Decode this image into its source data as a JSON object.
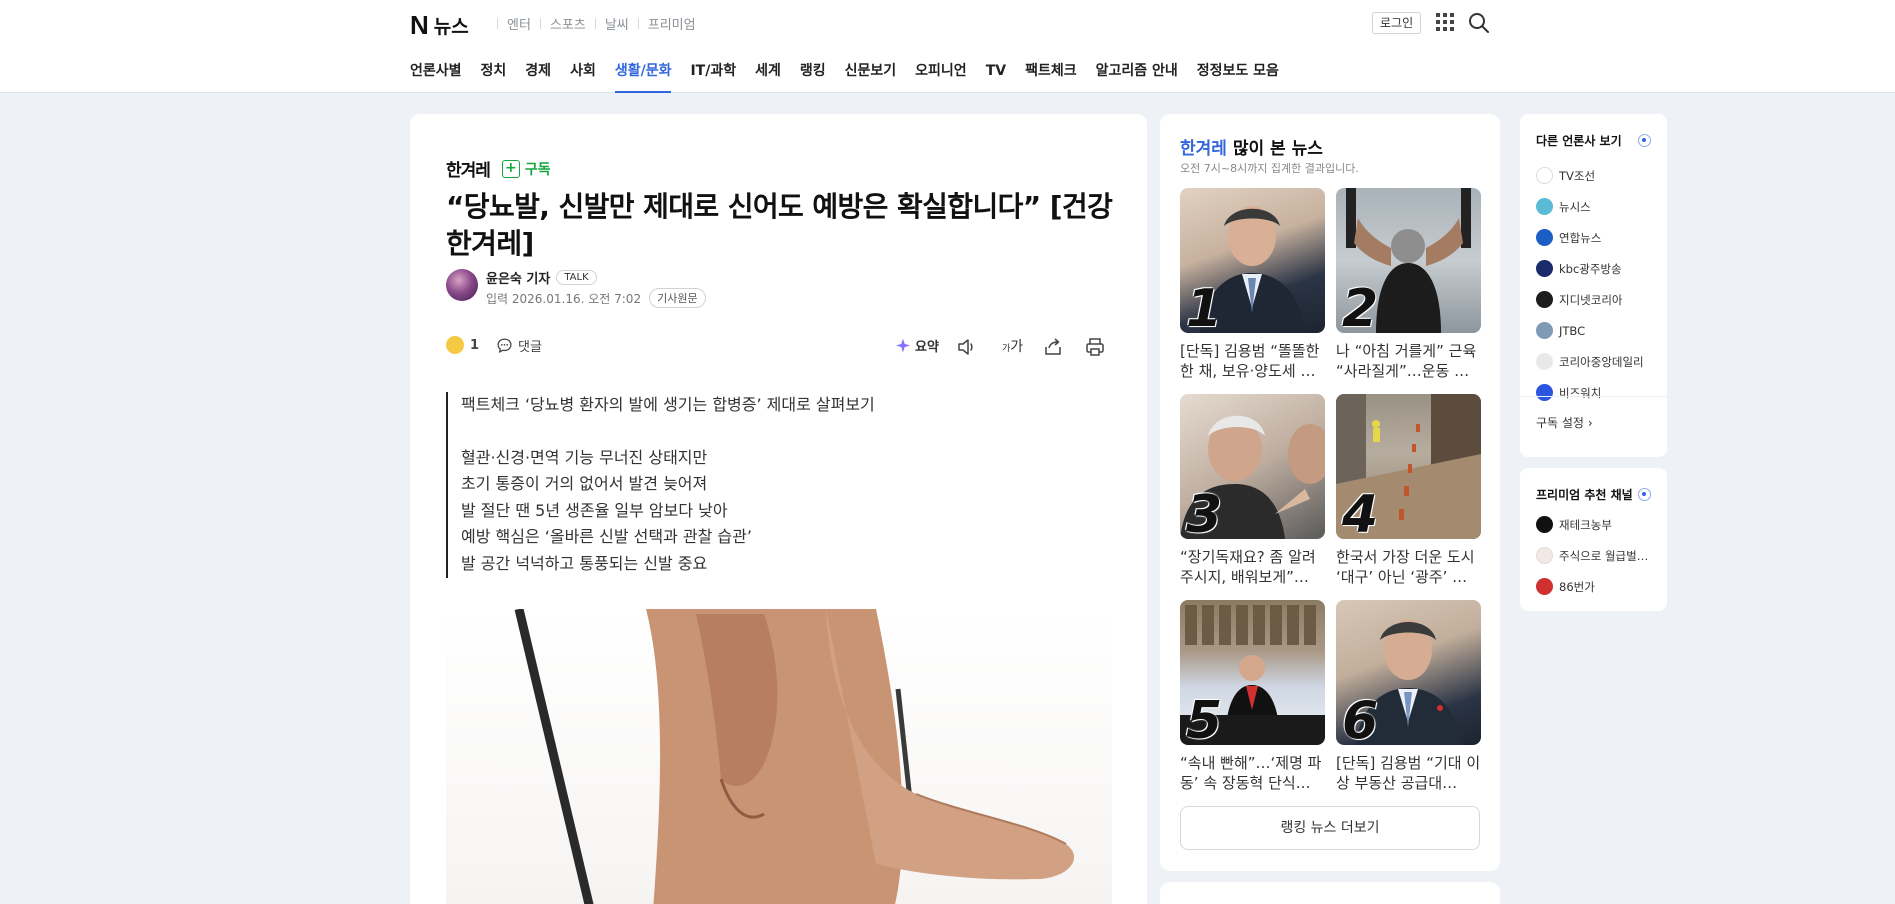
{
  "header": {
    "logo_n": "N",
    "logo_text": "뉴스",
    "top_links": [
      "엔터",
      "스포츠",
      "날씨",
      "프리미엄"
    ],
    "login_label": "로그인",
    "icons": {
      "apps": "apps-grid-icon",
      "search": "search-icon"
    }
  },
  "nav": {
    "items": [
      "언론사별",
      "정치",
      "경제",
      "사회",
      "생활/문화",
      "IT/과학",
      "세계",
      "랭킹",
      "신문보기",
      "오피니언",
      "TV",
      "팩트체크",
      "알고리즘 안내",
      "정정보도 모음"
    ],
    "active": "생활/문화",
    "accent_color": "#3366dd"
  },
  "article": {
    "press_name": "한겨레",
    "subscribe_label": "구독",
    "headline": "“당뇨발, 신발만 제대로 신어도 예방은 확실합니다” [건강한겨레]",
    "reporter": "윤은숙 기자",
    "talk_label": "TALK",
    "date": "입력 2026.01.16. 오전 7:02",
    "origin_label": "기사원문",
    "reaction_count": "1",
    "comment_label": "댓글",
    "summary_label": "요약",
    "font_label_small": "가",
    "font_label_big": "가",
    "summary_lines": [
      "팩트체크 ‘당뇨병 환자의 발에 생기는 합병증’ 제대로 살펴보기",
      "",
      "혈관·신경·면역 기능 무너진 상태지만",
      "초기 통증이 거의 없어서 발견 늦어져",
      "발 절단 땐 5년 생존율 일부 암보다 낮아",
      "예방 핵심은 ‘올바른 신발 선택과 관찰 습관’",
      "발 공간 넉넉하고 통풍되는 신발 중요"
    ]
  },
  "ranking": {
    "press": "한겨레",
    "title_rest": " 많이 본 뉴스",
    "subtitle": "오전 7시~8시까지 집계한 결과입니다.",
    "items": [
      {
        "rank": "1",
        "text": "[단독] 김용범 “똘똘한 한 채, 보유·양도세 …"
      },
      {
        "rank": "2",
        "text": "나 “아침 거를게” 근육 “사라질게”…운동 …"
      },
      {
        "rank": "3",
        "text": "“장기독재요? 좀 알려주시지, 배워보게”…"
      },
      {
        "rank": "4",
        "text": "한국서 가장 더운 도시 ‘대구’ 아닌 ‘광주’ …"
      },
      {
        "rank": "5",
        "text": "“속내 빤해”…‘제명 파동’ 속 장동혁 단식…"
      },
      {
        "rank": "6",
        "text": "[단독] 김용범 “기대 이상 부동산 공급대…"
      }
    ],
    "more_label": "랭킹 뉴스 더보기"
  },
  "other_press": {
    "title": "다른 언론사 보기",
    "items": [
      {
        "name": "TV조선",
        "color": "#ffffff"
      },
      {
        "name": "뉴시스",
        "color": "#5bbad5"
      },
      {
        "name": "연합뉴스",
        "color": "#1c5fc4"
      },
      {
        "name": "kbc광주방송",
        "color": "#1b2a6b"
      },
      {
        "name": "지디넷코리아",
        "color": "#1d1d1d"
      },
      {
        "name": "JTBC",
        "color": "#7f9ab5"
      },
      {
        "name": "코리아중앙데일리",
        "color": "#e9e9e9"
      },
      {
        "name": "비즈워치",
        "color": "#2a55e0"
      }
    ],
    "settings_label": "구독 설정"
  },
  "premium": {
    "title": "프리미엄 추천 채널",
    "items": [
      {
        "name": "재테크농부",
        "color": "#111111"
      },
      {
        "name": "주식으로 월급벌…",
        "color": "#f2e9e4"
      },
      {
        "name": "86번가",
        "color": "#d0302f"
      }
    ]
  }
}
